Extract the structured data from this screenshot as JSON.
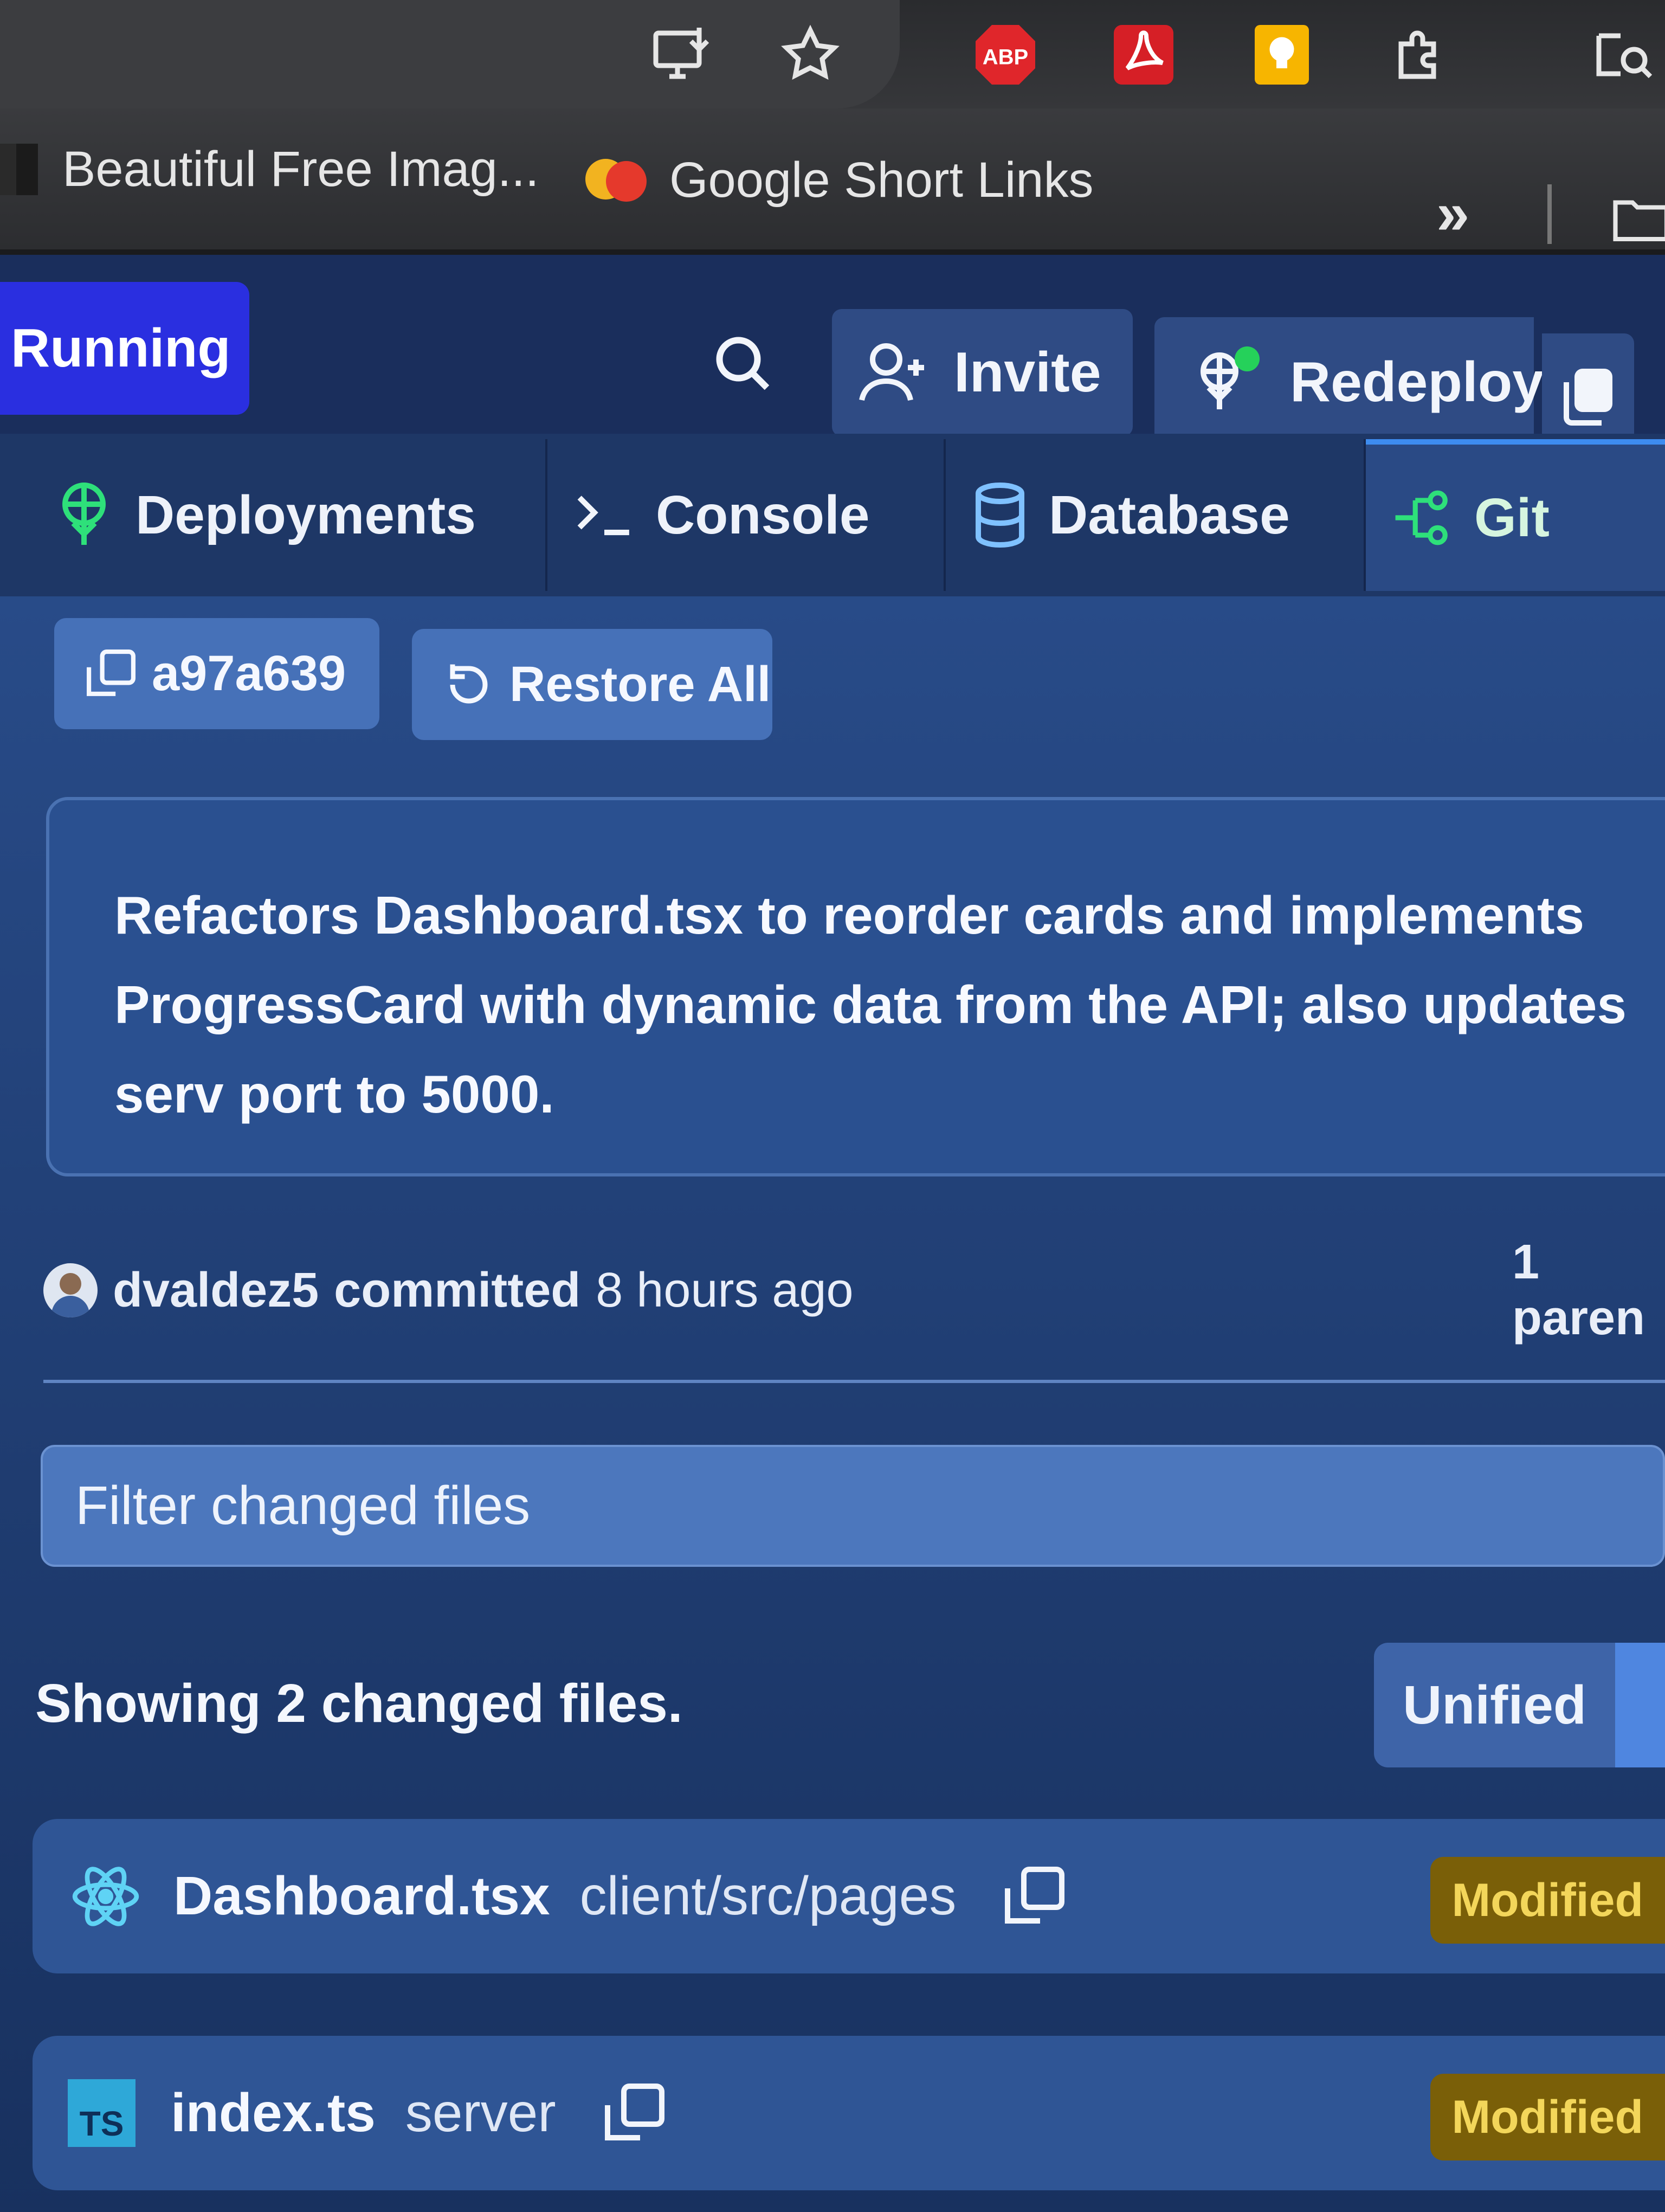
{
  "browser": {
    "toolbar_icons": [
      "install-icon",
      "star-icon",
      "adblock-icon",
      "pdf-icon",
      "keep-icon",
      "extensions-icon",
      "tab-search-icon"
    ],
    "adblock_label": "ABP",
    "bookmarks": [
      {
        "label": "Beautiful Free Imag...",
        "icon": "unsplash-icon"
      },
      {
        "label": "Google Short Links",
        "icon": "shortlinks-icon"
      }
    ],
    "overflow_label": "»"
  },
  "header": {
    "status": "Running",
    "invite_label": "Invite",
    "redeploy_label": "Redeploy"
  },
  "tabs": [
    {
      "label": "Deployments",
      "icon": "deployments-icon",
      "active": false
    },
    {
      "label": "Console",
      "icon": "terminal-icon",
      "active": false
    },
    {
      "label": "Database",
      "icon": "database-icon",
      "active": false
    },
    {
      "label": "Git",
      "icon": "git-branch-icon",
      "active": true
    }
  ],
  "commit": {
    "hash": "a97a639",
    "restore_label": "Restore All",
    "message": "Refactors Dashboard.tsx to reorder cards and implements ProgressCard with dynamic data from the API; also updates serv port to 5000.",
    "author": "dvaldez5",
    "action": "committed",
    "time": "8 hours ago",
    "parents": "1 paren"
  },
  "filter": {
    "placeholder": "Filter changed files"
  },
  "summary": "Showing 2 changed files.",
  "view_toggle": {
    "unified_label": "Unified"
  },
  "files": [
    {
      "name": "Dashboard.tsx",
      "path": "client/src/pages",
      "status": "Modified",
      "icon": "react-icon"
    },
    {
      "name": "index.ts",
      "path": "server",
      "status": "Modified",
      "icon": "typescript-icon",
      "icon_text": "TS"
    }
  ],
  "colors": {
    "running_badge": "#2a2fe0",
    "active_tab_accent": "#3d8cf0",
    "modified_badge_bg": "#7a5f08",
    "modified_badge_text": "#f3d65a",
    "react_icon": "#5fd3f5",
    "typescript_icon": "#2ea8d8"
  }
}
